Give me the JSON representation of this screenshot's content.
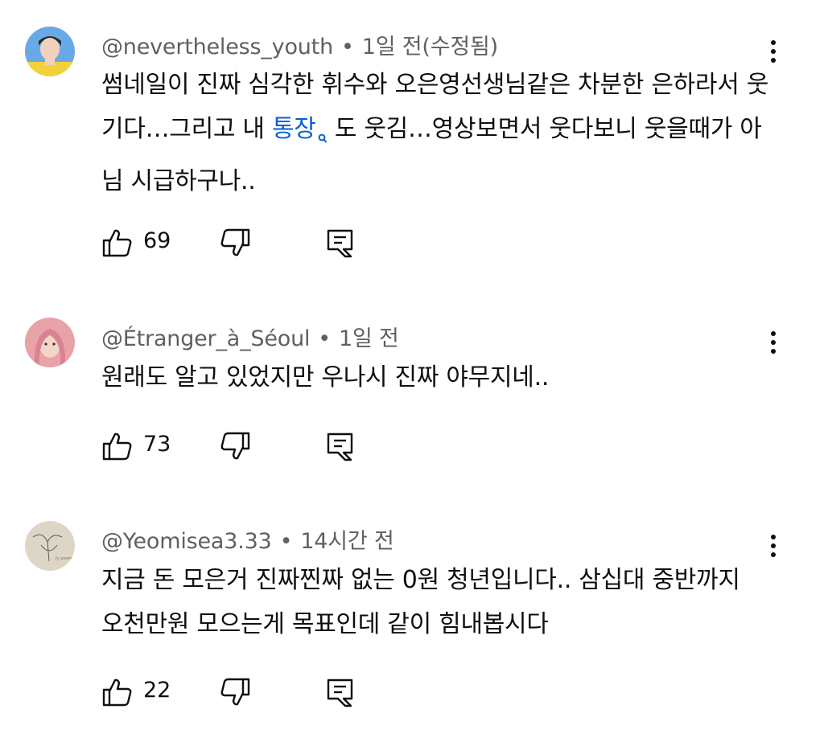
{
  "comments": [
    {
      "author": "@nevertheless_youth",
      "time": "1일 전",
      "edited": "(수정됨)",
      "text_before_link": "썸네일이 진짜 심각한 휘수와 오은영선생님같은 차분한 은하라서 웃기다…그리고 내 ",
      "link_text": "통장",
      "text_after_link": " 도 웃김…영상보면서 웃다보니 웃을때가 아님 시급하구나..",
      "likes": "69",
      "avatar_colors": {
        "bg": "#6aa9e8",
        "accent": "#f4d13a"
      }
    },
    {
      "author": "@Étranger_à_Séoul",
      "time": "1일 전",
      "text": "원래도 알고 있었지만 우나시 진짜 야무지네..",
      "likes": "73",
      "avatar_colors": {
        "bg": "#e7a3a8",
        "accent": "#f3d6c8"
      }
    },
    {
      "author": "@Yeomisea3.33",
      "time": "14시간 전",
      "text": "지금 돈 모은거 진짜찐짜 없는 0원 청년입니다.. 삼십대 중반까지 오천만원 모으는게 목표인데 같이 힘내봅시다",
      "likes": "22",
      "avatar_colors": {
        "bg": "#ddd6c6",
        "accent": "#5a5a5a"
      }
    }
  ],
  "icons": {
    "like": "thumbs-up-icon",
    "dislike": "thumbs-down-icon",
    "reply": "reply-icon",
    "more": "more-vert-icon",
    "search": "search-icon"
  },
  "colors": {
    "link": "#065fd4",
    "meta": "#606060",
    "text": "#0f0f0f"
  }
}
